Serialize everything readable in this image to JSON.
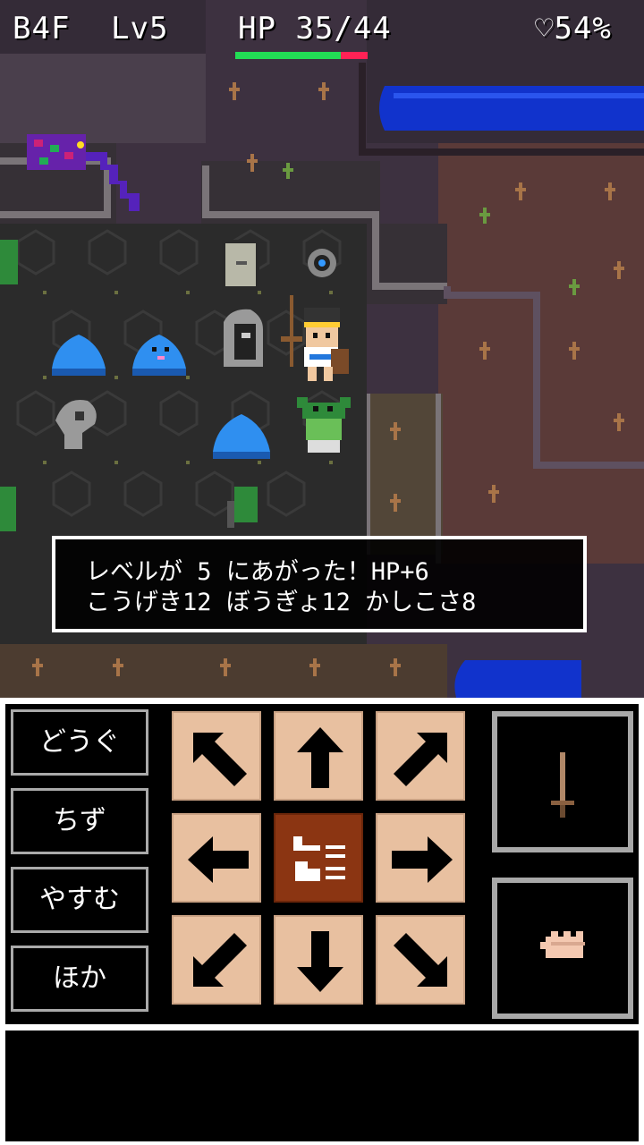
{
  "hud": {
    "floor": "B4F",
    "level": "Lv5",
    "hp_text": "HP 35/44",
    "hp_fraction": 0.795,
    "fullness": "♡54%"
  },
  "message": {
    "line1": "レベルが 5 にあがった！HP+6",
    "line2": "こうげき12 ぼうぎょ12 かしこさ8"
  },
  "menu": [
    {
      "label": "どうぐ"
    },
    {
      "label": "ちず"
    },
    {
      "label": "やすむ"
    },
    {
      "label": "ほか"
    }
  ],
  "dpad": [
    "up-left",
    "up",
    "up-right",
    "left",
    "center",
    "right",
    "down-left",
    "down",
    "down-right"
  ],
  "actions": {
    "attack_icon": "sword-icon",
    "grab_icon": "fist-icon"
  },
  "colors": {
    "hp_green": "#22dd55",
    "hp_red": "#ff2255",
    "water": "#1133cc",
    "slime": "#2f8ff0",
    "dpad_tile": "#e8c0a0",
    "dpad_center": "#8b3512"
  }
}
